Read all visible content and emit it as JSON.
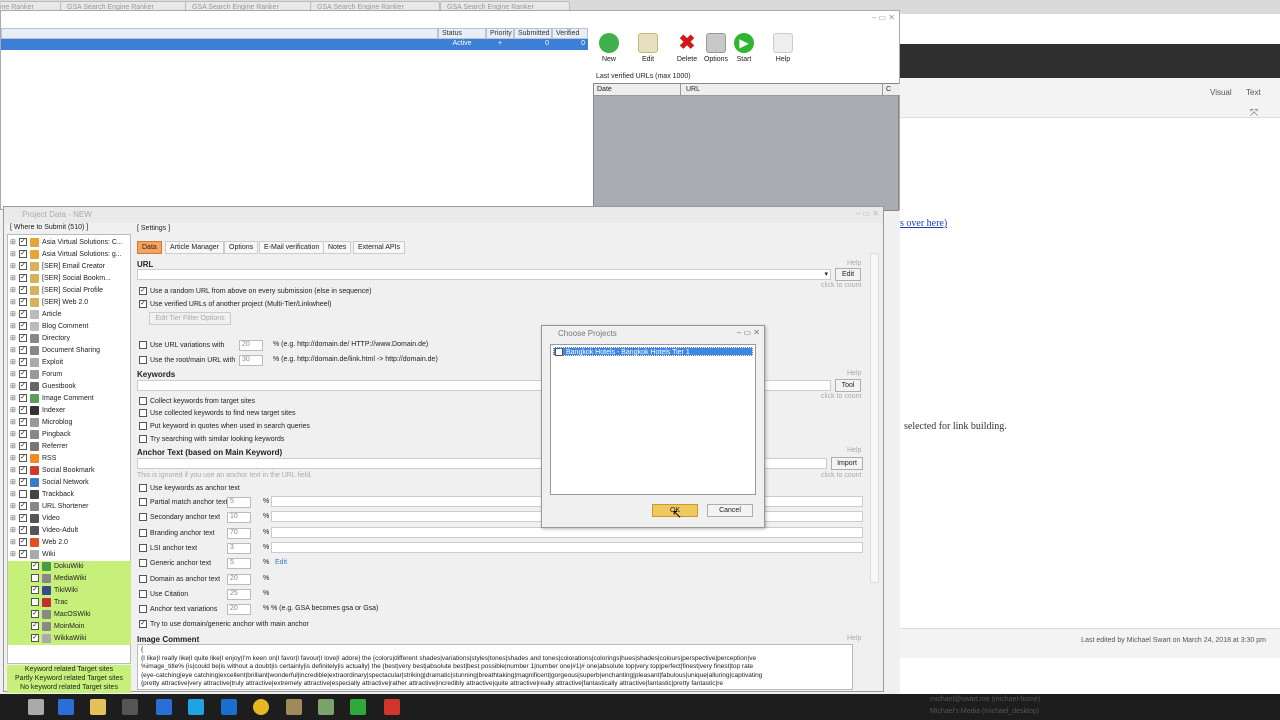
{
  "browser_tabs": [
    "GSA Search Engine Ranker",
    "GSA Search Engine Ranker",
    "GSA Search Engine Ranker",
    "GSA Search Engine Ranker",
    "GSA Search Engine Ranker"
  ],
  "editor": {
    "visual_tab": "Visual",
    "text_tab": "Text",
    "link_text": "s over here)",
    "body_text": "selected for link building.",
    "last_edited": "Last edited by Michael Swart on March 24, 2018 at 3:30 pm"
  },
  "main_window": {
    "columns": [
      "Status",
      "Priority",
      "Submitted",
      "Verified"
    ],
    "row": [
      "Active",
      "+",
      "0",
      "0"
    ],
    "toolbar": [
      "New",
      "Edit",
      "Delete",
      "Options",
      "Start",
      "Help"
    ],
    "last_verified_label": "Last verified URLs (max 1000)",
    "verified_columns": [
      "Date",
      "URL",
      "C"
    ]
  },
  "project_window": {
    "title": "Project Data - NEW",
    "tree_header": "[ Where to Submit (510) ]",
    "tree_items": [
      {
        "label": "Asia Virtual Solutions: C...",
        "checked": true,
        "icon": "#e8a23a"
      },
      {
        "label": "Asia Virtual Solutions: g...",
        "checked": true,
        "icon": "#e8a23a"
      },
      {
        "label": "[SER] Email Creator",
        "checked": true,
        "icon": "#d8b25a"
      },
      {
        "label": "[SER] Social Bookm...",
        "checked": true,
        "icon": "#d8b25a"
      },
      {
        "label": "[SER] Social Profile",
        "checked": true,
        "icon": "#d8b25a"
      },
      {
        "label": "[SER] Web 2.0",
        "checked": true,
        "icon": "#d8b25a"
      },
      {
        "label": "Article",
        "checked": true,
        "icon": "#bbbbbb"
      },
      {
        "label": "Blog Comment",
        "checked": true,
        "icon": "#bbbbbb"
      },
      {
        "label": "Directory",
        "checked": true,
        "icon": "#888888"
      },
      {
        "label": "Document Sharing",
        "checked": true,
        "icon": "#888888"
      },
      {
        "label": "Exploit",
        "checked": true,
        "icon": "#aaaaaa"
      },
      {
        "label": "Forum",
        "checked": true,
        "icon": "#999999"
      },
      {
        "label": "Guestbook",
        "checked": true,
        "icon": "#666666"
      },
      {
        "label": "Image Comment",
        "checked": true,
        "icon": "#5aa05a"
      },
      {
        "label": "Indexer",
        "checked": true,
        "icon": "#333333"
      },
      {
        "label": "Microblog",
        "checked": true,
        "icon": "#999999"
      },
      {
        "label": "Pingback",
        "checked": true,
        "icon": "#888888"
      },
      {
        "label": "Referrer",
        "checked": true,
        "icon": "#777777"
      },
      {
        "label": "RSS",
        "checked": true,
        "icon": "#f08a24"
      },
      {
        "label": "Social Bookmark",
        "checked": true,
        "icon": "#d03a2a"
      },
      {
        "label": "Social Network",
        "checked": true,
        "icon": "#3a7ad0"
      },
      {
        "label": "Trackback",
        "checked": false,
        "icon": "#444444"
      },
      {
        "label": "URL Shortener",
        "checked": true,
        "icon": "#888888"
      },
      {
        "label": "Video",
        "checked": true,
        "icon": "#555555"
      },
      {
        "label": "Video-Adult",
        "checked": true,
        "icon": "#555555"
      },
      {
        "label": "Web 2.0",
        "checked": true,
        "icon": "#e05020"
      },
      {
        "label": "Wiki",
        "checked": true,
        "icon": "#aaaaaa"
      }
    ],
    "wiki_children": [
      {
        "label": "DokuWiki",
        "checked": true,
        "icon": "#4a9a4a"
      },
      {
        "label": "MediaWiki",
        "checked": false,
        "icon": "#888888"
      },
      {
        "label": "TikiWiki",
        "checked": true,
        "icon": "#3a4a8a"
      },
      {
        "label": "Trac",
        "checked": false,
        "icon": "#c03030"
      },
      {
        "label": "MacOSWiki",
        "checked": true,
        "icon": "#888888"
      },
      {
        "label": "MoinMoin",
        "checked": true,
        "icon": "#888888"
      },
      {
        "label": "WikkaWiki",
        "checked": true,
        "icon": "#aaaaaa"
      }
    ],
    "legend": [
      "Keyword related Target sites",
      "Partly Keyword related Target sites",
      "No keyword related Target sites"
    ],
    "settings_header": "[ Settings ]",
    "tabs": [
      "Data",
      "Article Manager",
      "Options",
      "E-Mail verification",
      "Notes",
      "External APIs"
    ],
    "url_label": "URL",
    "edit_button": "Edit",
    "help": "Help",
    "click_to_count": "click to count",
    "opt_random_url": "Use a random URL from above on every submission (else in sequence)",
    "opt_verified_urls": "Use verified URLs of another project (Multi-Tier/Linkwheel)",
    "edit_tier_filter": "Edit Tier Filter Options",
    "opt_url_variations": "Use URL variations with",
    "url_variations_value": "20",
    "url_variations_hint": "% (e.g. http://domain.de/ HTTP://www.Domain.de)",
    "opt_root_url": "Use the root/main URL with",
    "root_url_value": "30",
    "root_url_hint": "% (e.g. http://domain.de/link.html -> http://domain.de)",
    "keywords_label": "Keywords",
    "tool_button": "Tool",
    "kw_opts": [
      "Collect keywords from target sites",
      "Use collected keywords to find new target sites",
      "Put keyword in quotes when used in search queries",
      "Try searching with similar looking keywords"
    ],
    "anchor_label": "Anchor Text (based on Main Keyword)",
    "import_button": "Import",
    "anchor_hint": "This is ignored if you use an anchor text in the URL field.",
    "anchor_use_kw": "Use keywords as anchor text",
    "anchor_rows": [
      {
        "label": "Partial match anchor text",
        "value": "5"
      },
      {
        "label": "Secondary anchor text",
        "value": "10"
      },
      {
        "label": "Branding anchor text",
        "value": "70"
      },
      {
        "label": "LSI anchor text",
        "value": "3"
      },
      {
        "label": "Generic anchor text",
        "value": "5"
      },
      {
        "label": "Domain as anchor text",
        "value": "20"
      },
      {
        "label": "Use Citation",
        "value": "25"
      },
      {
        "label": "Anchor text variations",
        "value": "20"
      }
    ],
    "generic_edit": "Edit",
    "anchor_variation_hint": "% (e.g. GSA becomes gsa or Gsa)",
    "try_domain": "Try to use domain/generic anchor with main anchor",
    "image_comment_label": "Image Comment",
    "image_comment_text": "{\n{I like|I really like|I quite like|I enjoy|I'm keen on|I favor|I favour|I love|I adore} the {colors|different shades|variations|styles|tones|shades and tones|colorations|colorings|hues|shades|colours|perspective|perception|ve\n%image_title% {is|could be|is without a doubt|is certainly|is definitely|is actually} the {best|very best|absolute best|best possible|number 1|number one|#1|# one|absolute top|very top|perfect|finest|very finest|top rate\n{eye-catching|eye catching|excellent|brilliant|wonderful|incredible|extraordinary|spectacular|striking|dramatic|stunning|breathtaking|magnificent|gorgeous|superb|enchanting|pleasant|fabulous|unique|alluring|captivating\n{pretty attractive|very attractive|truly attractive|extremely attractive|especially attractive|rather attractive|incredibly attractive|quite attractive|really attractive|fantastically attractive|fantastic|pretty fantastic|re"
  },
  "choose_dialog": {
    "title": "Choose Projects",
    "item": "Bangkok Hotels - Bangkok Hotels Tier 1",
    "ok": "OK",
    "cancel": "Cancel"
  },
  "taskbar_right": [
    "michael@swart.me (michael-home)",
    "Michael's Media (michael_desktop)"
  ]
}
